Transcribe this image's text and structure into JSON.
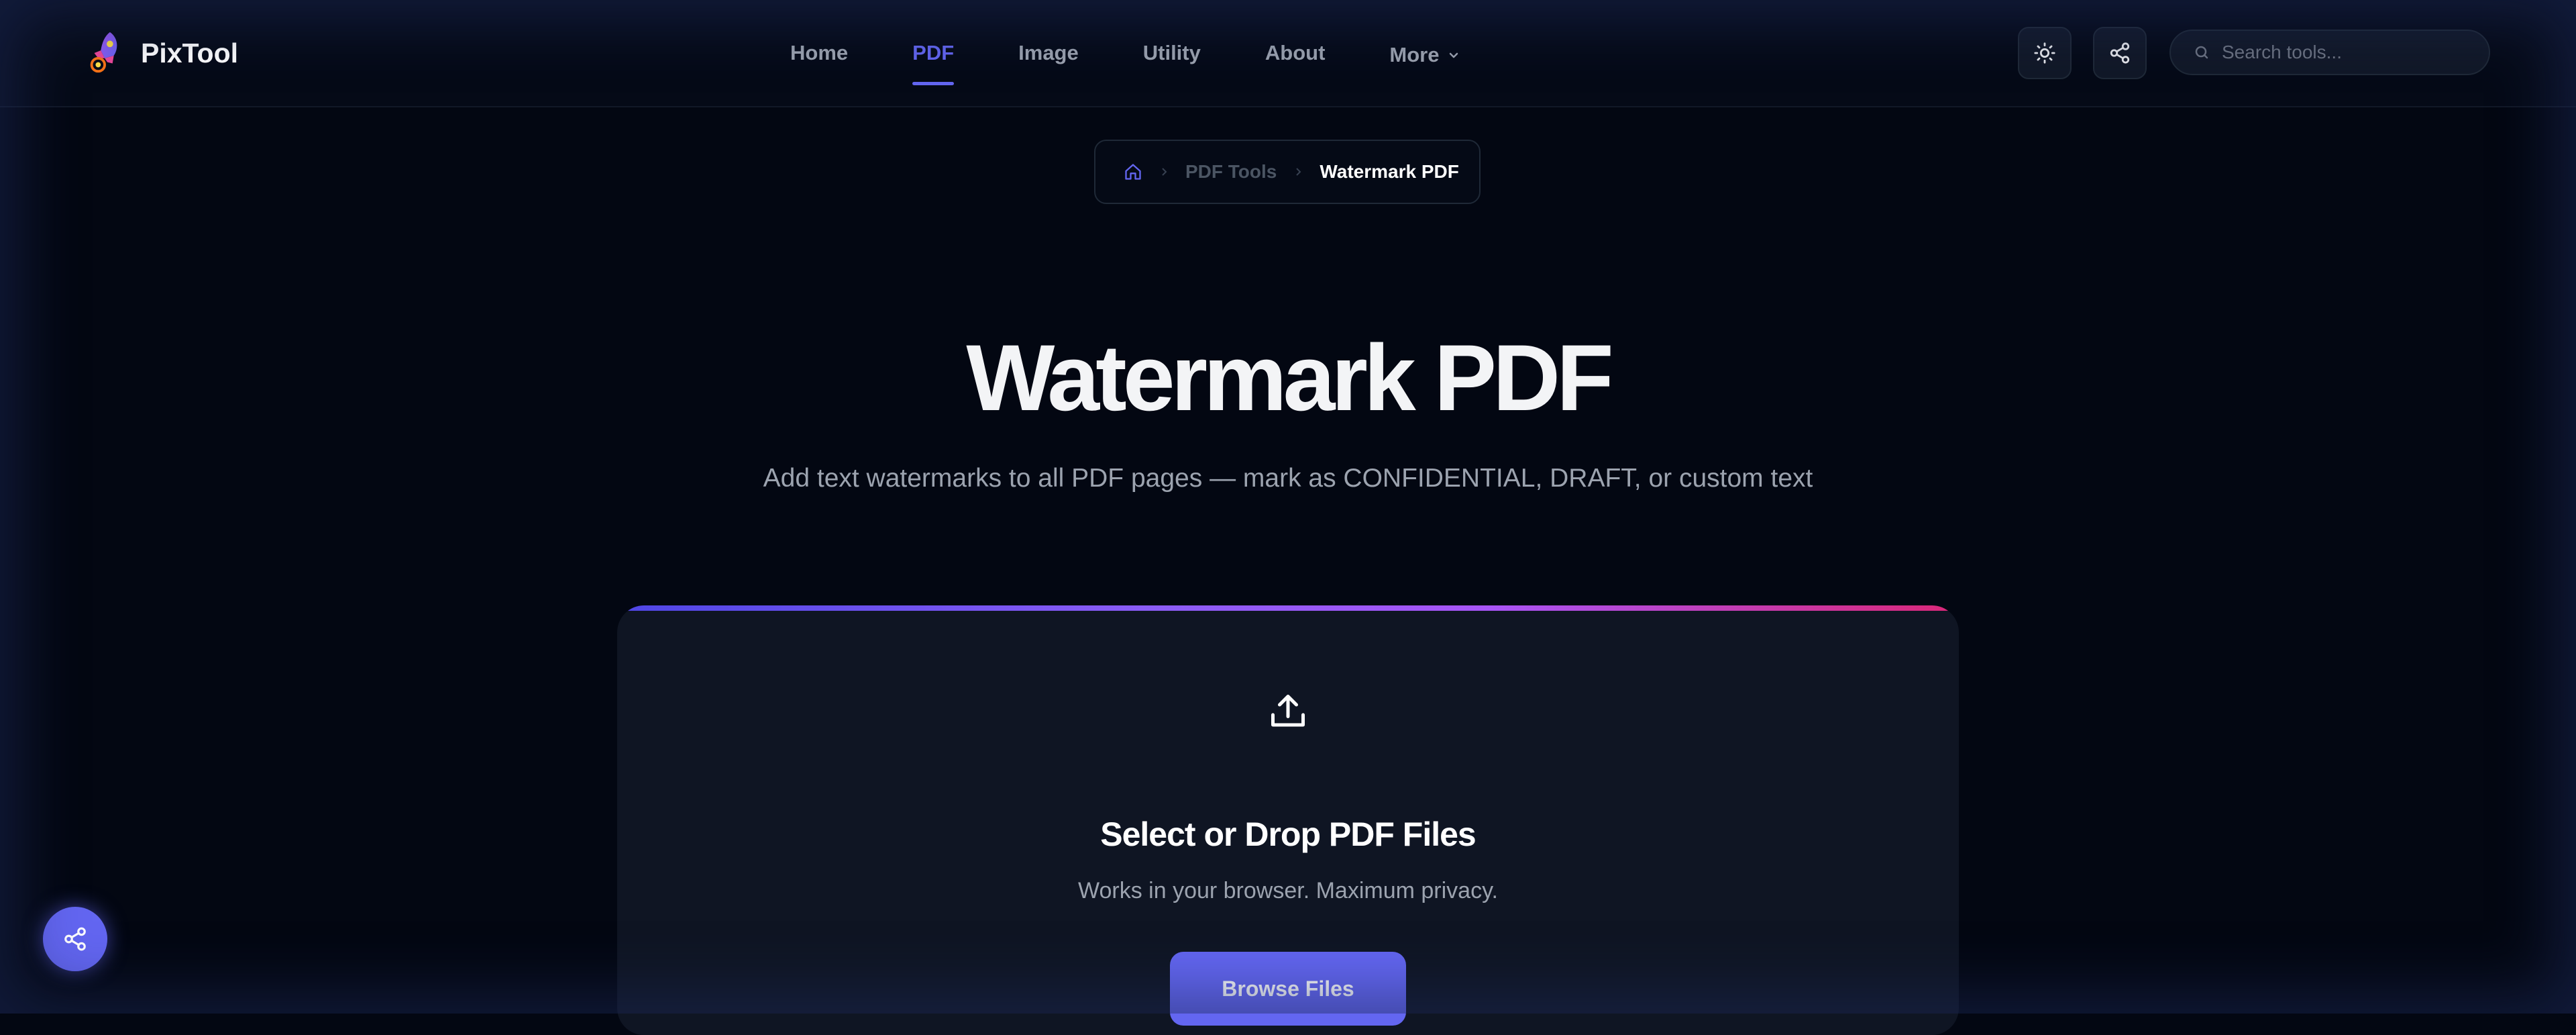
{
  "brand": {
    "name": "PixTool",
    "logo_icon": "rocket-icon"
  },
  "nav": {
    "items": [
      {
        "label": "Home",
        "active": false
      },
      {
        "label": "PDF",
        "active": true
      },
      {
        "label": "Image",
        "active": false
      },
      {
        "label": "Utility",
        "active": false
      },
      {
        "label": "About",
        "active": false
      },
      {
        "label": "More",
        "active": false,
        "icon": "chevron-down-icon"
      }
    ]
  },
  "header_actions": {
    "theme_icon": "sun-icon",
    "share_icon": "share-icon",
    "search_placeholder": "Search tools...",
    "search_value": ""
  },
  "breadcrumb": {
    "home_icon": "home-icon",
    "items": [
      "PDF Tools",
      "Watermark PDF"
    ]
  },
  "hero": {
    "title": "Watermark PDF",
    "subtitle": "Add text watermarks to all PDF pages — mark as CONFIDENTIAL, DRAFT, or custom text"
  },
  "upload": {
    "icon": "upload-icon",
    "title": "Select or Drop PDF Files",
    "subtitle": "Works in your browser. Maximum privacy.",
    "button_label": "Browse Files"
  },
  "fab": {
    "icon": "share-icon"
  },
  "colors": {
    "accent": "#6366f1",
    "background": "#030712",
    "card": "#0f1523",
    "gradient_start": "#4f46e5",
    "gradient_end": "#db2777"
  }
}
